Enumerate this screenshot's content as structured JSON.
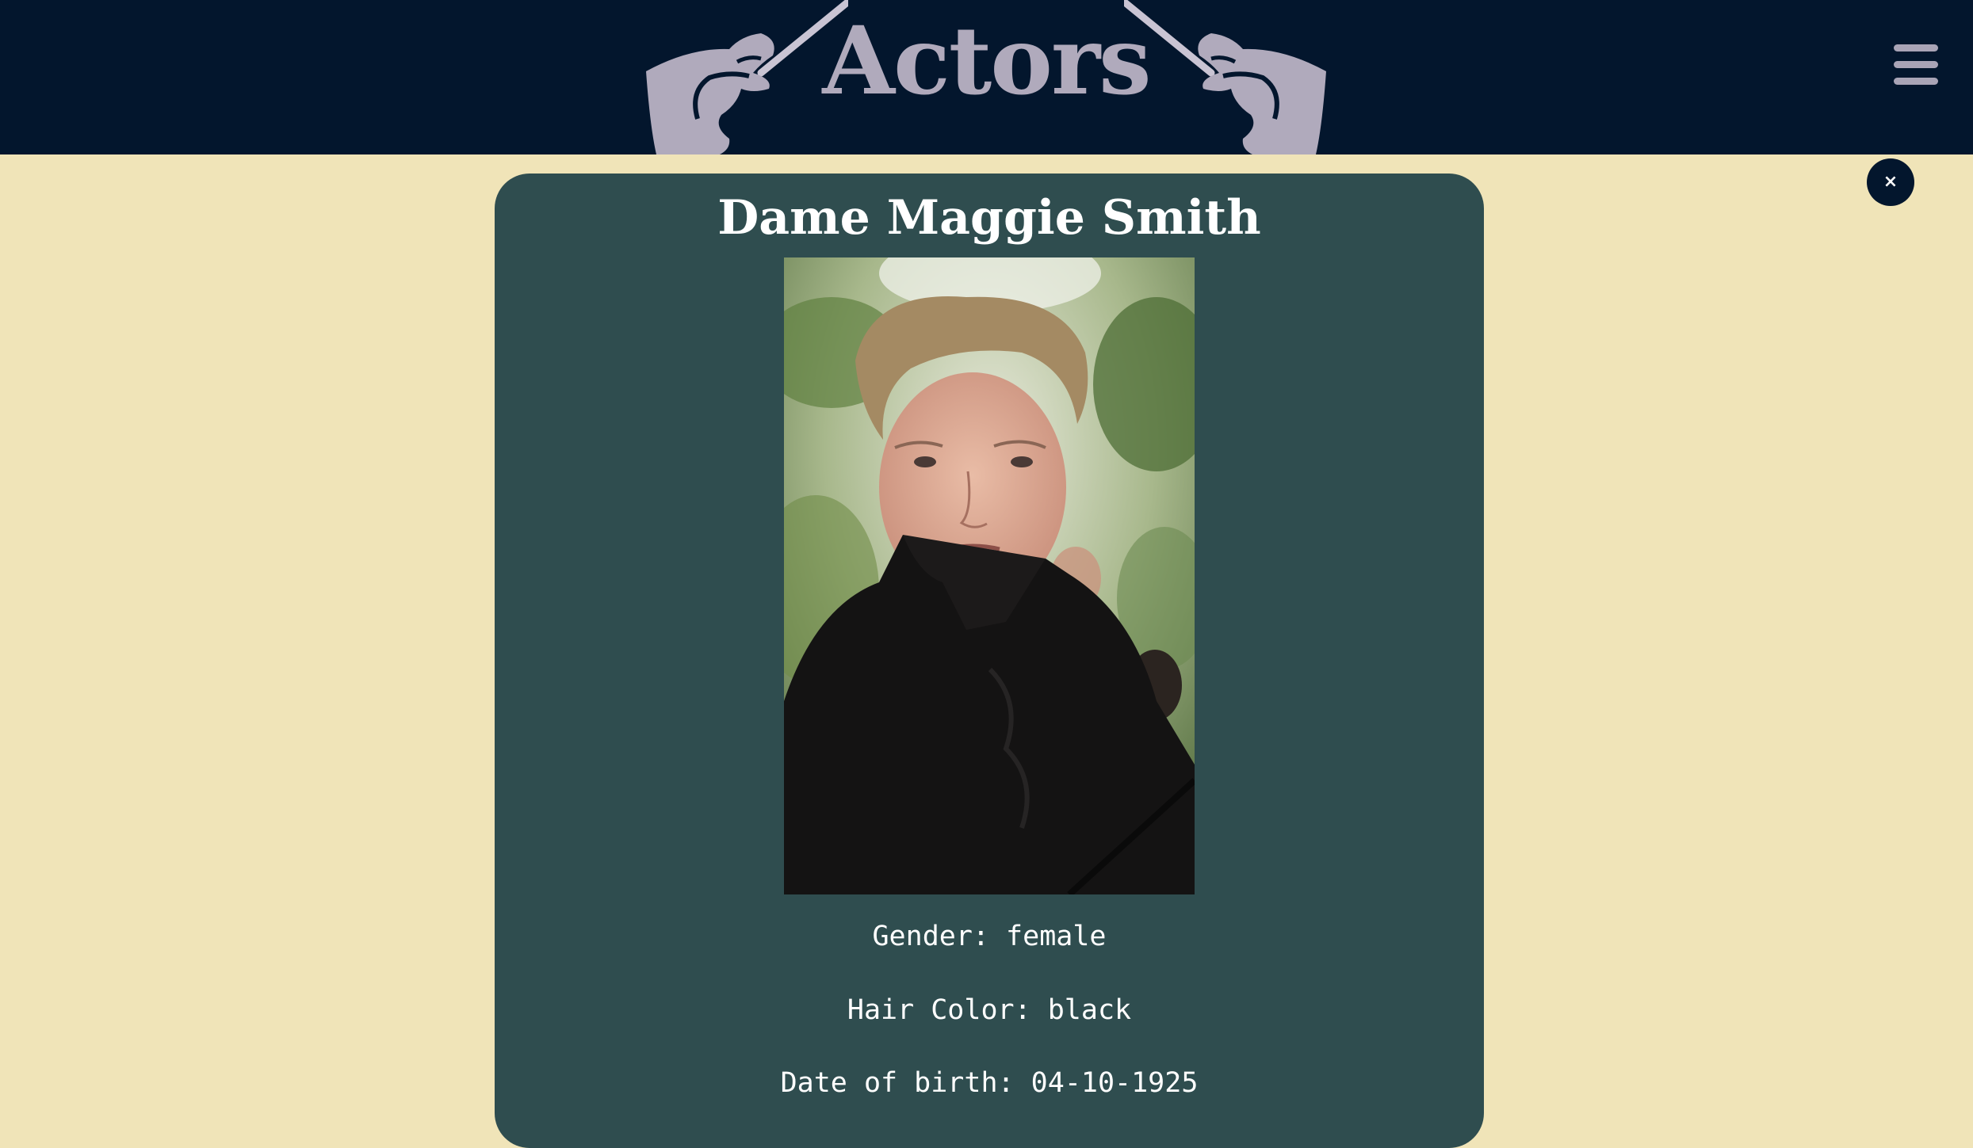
{
  "header": {
    "title": "Actors",
    "menu_icon": "hamburger-menu-icon"
  },
  "close_label": "×",
  "actor": {
    "name": "Dame Maggie Smith",
    "gender_text": "Gender: female",
    "hair_color_text": "Hair Color: black",
    "date_of_birth_text": "Date of birth: 04-10-1925"
  },
  "colors": {
    "header_bg": "#03162d",
    "page_bg": "#f0e4b8",
    "card_bg": "#2f4d4f",
    "accent_grey": "#b0aabc"
  }
}
